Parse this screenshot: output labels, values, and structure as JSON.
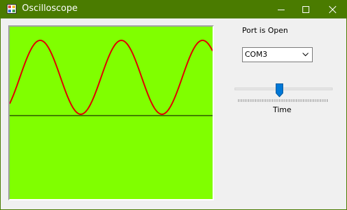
{
  "window": {
    "title": "Oscilloscope",
    "accent_color": "#4a7b00",
    "icons": [
      "app-icon",
      "minimize-icon",
      "maximize-icon",
      "close-icon"
    ]
  },
  "scope": {
    "background_color": "#80ff00",
    "wave_color": "#e00000",
    "baseline_color": "#000000",
    "cycles_visible": 2.5
  },
  "port": {
    "status": "Port is Open",
    "selected": "COM3"
  },
  "time_slider": {
    "label": "Time",
    "value_fraction": 0.45
  }
}
